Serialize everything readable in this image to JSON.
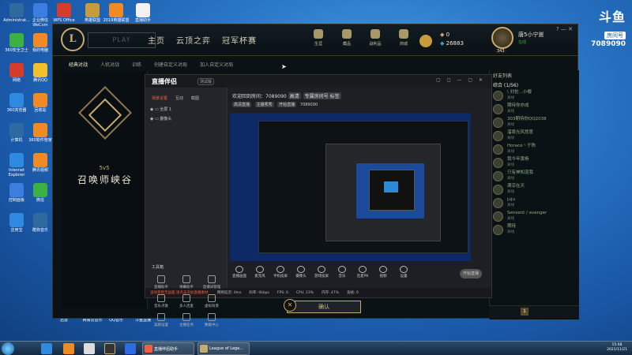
{
  "desktop_icons": [
    {
      "label": "Administrat...",
      "color": "#2e6a9e"
    },
    {
      "label": "企业微信 WeCom",
      "color": "#3c7ee0"
    },
    {
      "label": "WPS Office",
      "color": "#d43c2c"
    },
    {
      "label": "英雄联盟",
      "color": "#c89b3c"
    },
    {
      "label": "2019英雄联盟",
      "color": "#f08a24"
    },
    {
      "label": "直播助手",
      "color": "#f2f2f2"
    },
    {
      "label": "360安全卫士",
      "color": "#3cb043"
    },
    {
      "label": "我的电脑",
      "color": "#f08a24"
    },
    {
      "label": "网络",
      "color": "#d43c2c"
    },
    {
      "label": "腾讯QQ",
      "color": "#f2c02c"
    },
    {
      "label": "360浏览器",
      "color": "#2e8ae0"
    },
    {
      "label": "回收站",
      "color": "#f08a24"
    },
    {
      "label": "计算机",
      "color": "#2e6a9e"
    },
    {
      "label": "360软件管家",
      "color": "#f08a24"
    },
    {
      "label": "Internet Explorer",
      "color": "#2e8ae0"
    },
    {
      "label": "腾讯视频",
      "color": "#f08a24"
    },
    {
      "label": "控制面板",
      "color": "#3c7ee0"
    },
    {
      "label": "微信",
      "color": "#3cb043"
    },
    {
      "label": "应用宝",
      "color": "#2e8ae0"
    },
    {
      "label": "酷狗音乐",
      "color": "#2e6a9e"
    },
    {
      "label": "迅雷",
      "color": "#1c3a6a"
    },
    {
      "label": "网易云音乐",
      "color": "#d43c2c"
    },
    {
      "label": "QQ音乐",
      "color": "#f08a24"
    },
    {
      "label": "斗鱼直播",
      "color": "#f08a24"
    }
  ],
  "watermark": {
    "logo": "斗鱼",
    "sub": "房间号",
    "room": "7089090"
  },
  "client": {
    "play_label": "PLAY",
    "nav": [
      "主页",
      "云顶之弈",
      "冠军杯赛"
    ],
    "icon_nav": [
      "生涯",
      "藏品",
      "战利品",
      "商城"
    ],
    "currency": {
      "be": "0",
      "rp": "26883"
    },
    "profile": {
      "name": "唐5小宁崽",
      "status": "在线",
      "level": "343"
    },
    "window_controls": "? — ✕",
    "subnav": [
      "经典对战",
      "人机对战",
      "训练",
      "创建自定义对局",
      "加入自定义对局"
    ],
    "mode_sub": "5v5",
    "mode_name": "召唤师峡谷",
    "confirm_label": "确认",
    "friends": {
      "header": "好友列表",
      "group": "综合 (1/56)",
      "items": [
        {
          "name": "\\ 刘佐...小樱",
          "status": "离线"
        },
        {
          "name": "期待你亦成",
          "status": "离线"
        },
        {
          "name": "303期待你QQ2038",
          "status": "离线"
        },
        {
          "name": "溜梁光风悠意",
          "status": "离线"
        },
        {
          "name": "Horace丶于陈",
          "status": "离线"
        },
        {
          "name": "我今年黄杨",
          "status": "离线"
        },
        {
          "name": "只有神知道我",
          "status": "离线"
        },
        {
          "name": "满凉在天",
          "status": "离线"
        },
        {
          "name": "juju",
          "status": "离线"
        },
        {
          "name": "Sensent / avenger",
          "status": "离线"
        },
        {
          "name": "期待",
          "status": "离线"
        }
      ],
      "bottom_count": "1"
    }
  },
  "stream": {
    "title": "直播伴侣",
    "tag": "测试版",
    "tabs": [
      "场景设置",
      "互动",
      "截图"
    ],
    "scenes": [
      "全屏 1",
      "摄像头"
    ],
    "tools_label": "工具箱",
    "tools": [
      "直播助手",
      "弹幕助手",
      "直播间管理",
      "音乐点歌",
      "多人连麦",
      "虚拟背景",
      "美颜设置",
      "主播任务",
      "数据中心",
      "直播工具"
    ],
    "info": "欢迎回到房间：7089090",
    "info_badge1": "高清",
    "info_badge2": "专属房间号 标签",
    "info2_badges": [
      "高清直播",
      "主播秀秀",
      "开始直播"
    ],
    "room": "7089090",
    "controls": [
      "直播画面",
      "麦克风",
      "手机投屏",
      "摄像头",
      "游戏投屏",
      "音乐",
      "连麦PK",
      "视频",
      "设置"
    ],
    "go_live": "开始直播",
    "status": [
      "网络延迟: 0ms",
      "码率: 0kbps",
      "FPS: 0",
      "CPU: 23%",
      "内存: 47%",
      "丢帧: 0"
    ],
    "warning": "该场景暂无画面,请点击添加直播素材"
  },
  "taskbar": {
    "windows": [
      "直播伴侣助手",
      "League of Lege..."
    ],
    "time": "15:48",
    "date": "2021/11/21"
  }
}
